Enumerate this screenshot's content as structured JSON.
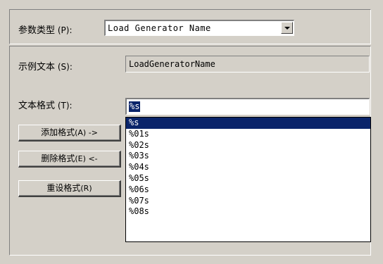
{
  "param_type": {
    "label": "参数类型",
    "mnemonic": "(P)",
    "value": "Load Generator Name"
  },
  "sample_text": {
    "label": "示例文本",
    "mnemonic": "(S)",
    "value": "LoadGeneratorName"
  },
  "text_format": {
    "label": "文本格式",
    "mnemonic": "(T)",
    "value": "%s"
  },
  "buttons": {
    "add": {
      "label": "添加格式",
      "mnemonic": "(A)",
      "arrow": "->"
    },
    "remove": {
      "label": "删除格式",
      "mnemonic": "(E)",
      "arrow": "<-"
    },
    "reset": {
      "label": "重设格式",
      "mnemonic": "(R)"
    }
  },
  "format_list": {
    "items": [
      "%s",
      "%01s",
      "%02s",
      "%03s",
      "%04s",
      "%05s",
      "%06s",
      "%07s",
      "%08s"
    ],
    "selected_index": 0
  }
}
